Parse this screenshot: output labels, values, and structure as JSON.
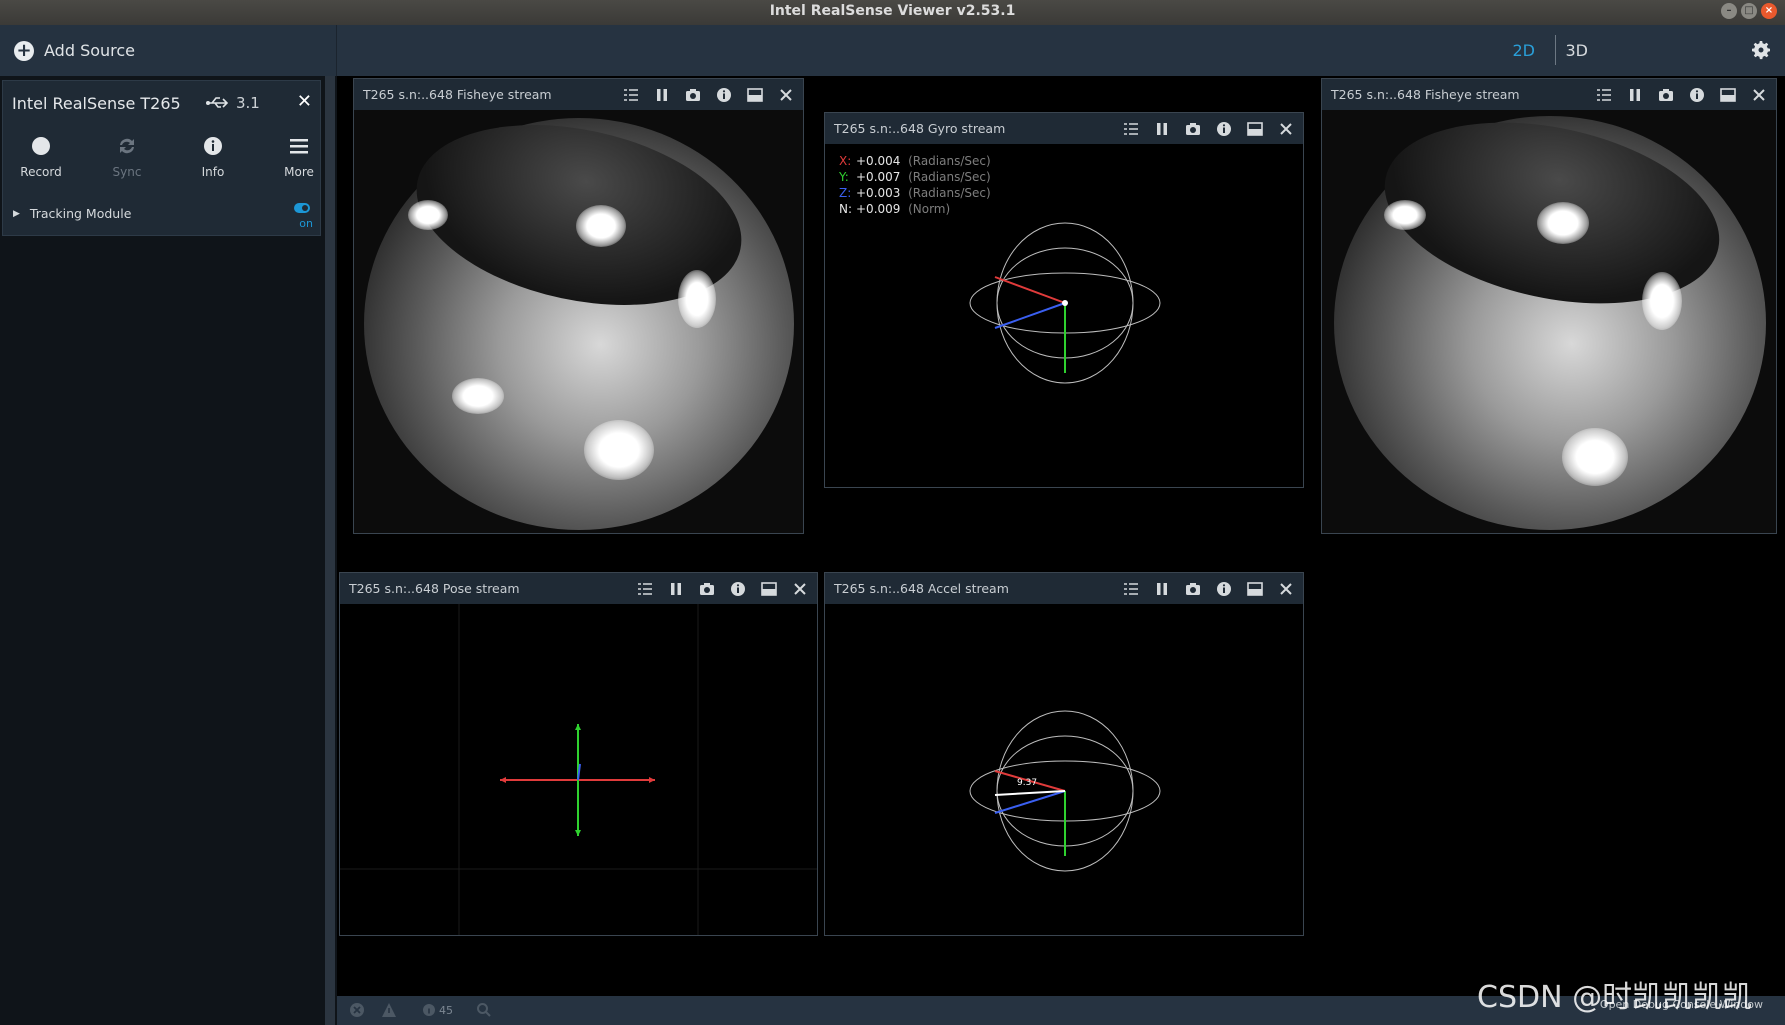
{
  "window": {
    "title": "Intel RealSense Viewer v2.53.1"
  },
  "toolbar": {
    "add_source": "Add Source",
    "mode_2d": "2D",
    "mode_3d": "3D"
  },
  "device": {
    "name": "Intel RealSense T265",
    "usb": "3.1",
    "buttons": {
      "record": "Record",
      "sync": "Sync",
      "info": "Info",
      "more": "More"
    },
    "module": {
      "label": "Tracking Module",
      "state": "on"
    }
  },
  "streams": {
    "fisheye1": {
      "title": "T265 s.n:..648 Fisheye stream"
    },
    "gyro": {
      "title": "T265 s.n:..648 Gyro stream",
      "rows": [
        {
          "axis": "X:",
          "value": "+0.004",
          "unit": "(Radians/Sec)",
          "color": "#e03b3b"
        },
        {
          "axis": "Y:",
          "value": "+0.007",
          "unit": "(Radians/Sec)",
          "color": "#2fd12f"
        },
        {
          "axis": "Z:",
          "value": "+0.003",
          "unit": "(Radians/Sec)",
          "color": "#3a5ff0"
        },
        {
          "axis": "N:",
          "value": "+0.009",
          "unit": "(Norm)",
          "color": "#e6e6e6"
        }
      ]
    },
    "fisheye2": {
      "title": "T265 s.n:..648 Fisheye stream"
    },
    "pose": {
      "title": "T265 s.n:..648 Pose stream"
    },
    "accel": {
      "title": "T265 s.n:..648 Accel stream",
      "norm_label": "9.37"
    }
  },
  "statusbar": {
    "count": "45",
    "console": "Open Debug Console Window"
  },
  "watermark": "CSDN @时凯凯凯凯"
}
